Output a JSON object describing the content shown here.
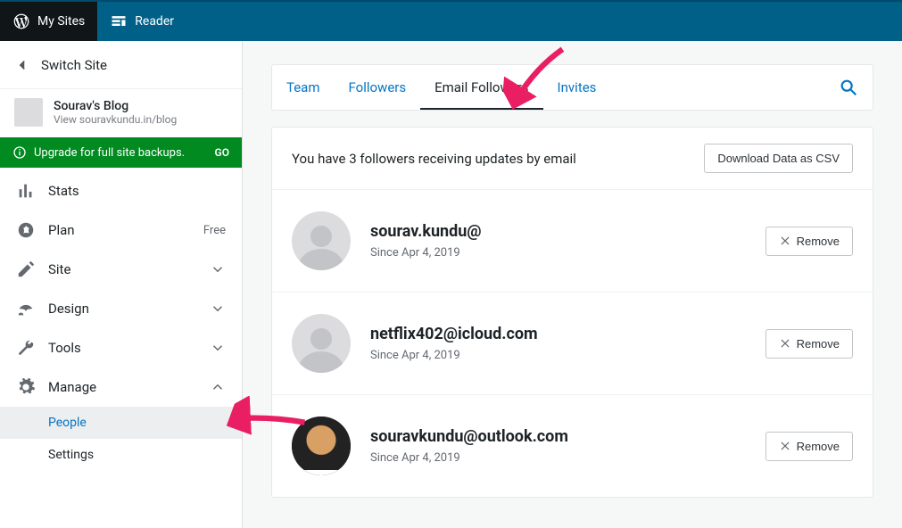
{
  "masterbar": {
    "my_sites": "My Sites",
    "reader": "Reader"
  },
  "switch_site": "Switch Site",
  "site": {
    "name": "Sourav's Blog",
    "url": "View souravkundu.in/blog"
  },
  "upgrade": {
    "text": "Upgrade for full site backups.",
    "cta": "GO"
  },
  "nav": {
    "stats": "Stats",
    "plan": "Plan",
    "plan_badge": "Free",
    "site": "Site",
    "design": "Design",
    "tools": "Tools",
    "manage": "Manage",
    "people": "People",
    "settings": "Settings"
  },
  "tabs": {
    "team": "Team",
    "followers": "Followers",
    "email_followers": "Email Followers",
    "invites": "Invites"
  },
  "panel": {
    "message": "You have 3 followers receiving updates by email",
    "download": "Download Data as CSV",
    "remove": "Remove"
  },
  "followers_list": [
    {
      "email": "sourav.kundu@",
      "since": "Since Apr 4, 2019",
      "avatar": "default"
    },
    {
      "email": "netflix402@icloud.com",
      "since": "Since Apr 4, 2019",
      "avatar": "default"
    },
    {
      "email": "souravkundu@outlook.com",
      "since": "Since Apr 4, 2019",
      "avatar": "photo"
    }
  ]
}
